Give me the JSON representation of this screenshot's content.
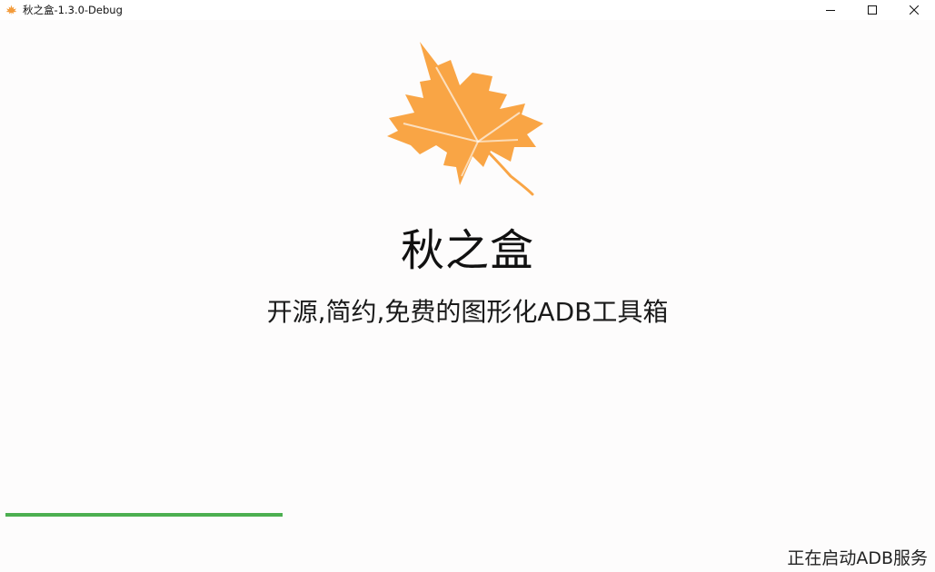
{
  "window": {
    "title": "秋之盒-1.3.0-Debug",
    "icon": "maple-leaf-icon",
    "controls": [
      "minimize-icon",
      "maximize-icon",
      "close-icon"
    ]
  },
  "splash": {
    "app_name": "秋之盒",
    "tagline": "开源,简约,免费的图形化ADB工具箱",
    "logo": "maple-leaf-icon",
    "status": "正在启动ADB服务",
    "progress": 0.3
  },
  "colors": {
    "leaf": "#f9a545",
    "progress": "#4caf50",
    "background": "#fdfcfc"
  }
}
